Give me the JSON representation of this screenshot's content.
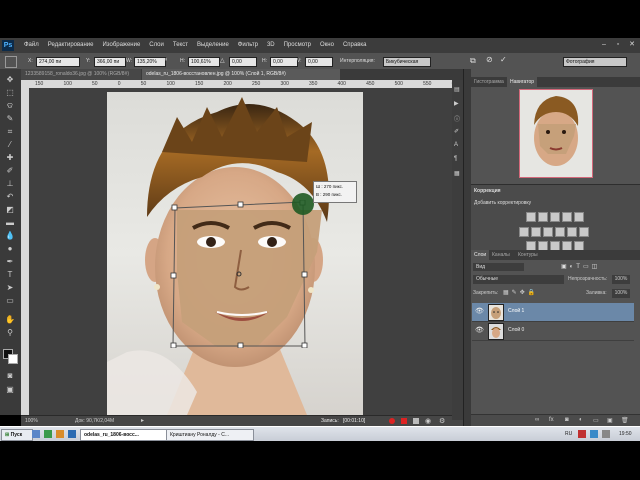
{
  "app": {
    "logo": "Ps"
  },
  "menu": [
    "Файл",
    "Редактирование",
    "Изображение",
    "Слои",
    "Текст",
    "Выделение",
    "Фильтр",
    "3D",
    "Просмотр",
    "Окно",
    "Справка"
  ],
  "options": {
    "x_label": "X:",
    "x_value": "274,00 пи",
    "y_label": "Y:",
    "y_value": "366,00 пи",
    "w_label": "W:",
    "w_value": "135,20%",
    "h_label": "H:",
    "h_value": "100,61%",
    "angle_value": "0,00",
    "hskew_label": "H:",
    "hskew_value": "0,00",
    "vskew_label": "V:",
    "vskew_value": "0,00",
    "interp_label": "Интерполяция:",
    "interp_value": "Бикубическая",
    "workspace_value": "Фотография"
  },
  "tabs": [
    {
      "label": "1233589158_ronaldo36.jpg @ 100% (RGB/8#)",
      "active": false
    },
    {
      "label": "odelas_ru_1806-восстановлен.jpg @ 100% (Слой 1, RGB/8#)",
      "active": true
    }
  ],
  "ruler_ticks": [
    "150",
    "100",
    "50",
    "0",
    "50",
    "100",
    "150",
    "200",
    "250",
    "300",
    "350",
    "400",
    "450",
    "500",
    "550",
    "600"
  ],
  "transform_tooltip": {
    "w": "Ш : 270 пикс.",
    "h": "В : 290 пикс."
  },
  "status": {
    "zoom": "100%",
    "doc": "Док: 90,7К/2,04М"
  },
  "recording": {
    "label": "Запись:",
    "time": "[00:01:10]"
  },
  "navigator": {
    "tabs": [
      "Гистограмма",
      "Навигатор"
    ],
    "active": "Навигатор"
  },
  "adjustments": {
    "title": "Коррекция",
    "subtitle": "Добавить корректировку"
  },
  "layers": {
    "tabs": [
      "Слои",
      "Каналы",
      "Контуры"
    ],
    "active": "Слои",
    "kind": "Вид",
    "blend": "Обычные",
    "opacity_label": "Непрозрачность:",
    "opacity_value": "100%",
    "lock_label": "Закрепить:",
    "fill_label": "Заливка:",
    "fill_value": "100%",
    "items": [
      {
        "name": "Слой 1",
        "selected": true
      },
      {
        "name": "Слой 0",
        "selected": false
      }
    ]
  },
  "taskbar": {
    "start": "Пуск",
    "items": [
      "odelas_ru_1806-восс...",
      "Криштиану Роналду - С..."
    ],
    "lang": "RU",
    "clock": "19:50"
  },
  "colors": {
    "accent": "#6b88a8",
    "ui_bg": "#535353",
    "dark_bg": "#3a3a3a"
  }
}
